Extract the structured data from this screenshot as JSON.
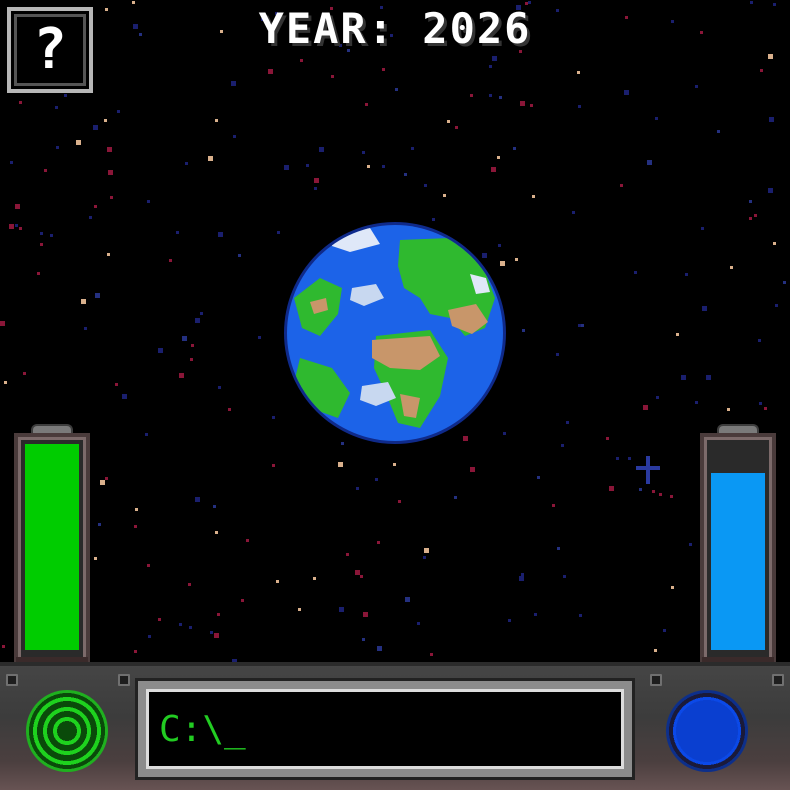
{
  "header": {
    "year_label": "YEAR: 2026"
  },
  "help_button": {
    "label": "?"
  },
  "gauges": {
    "energy": {
      "level": 1.0,
      "color": "#00cc00"
    },
    "water": {
      "level": 0.86,
      "color": "#0a98f4"
    }
  },
  "console": {
    "prompt": "C:\\_"
  },
  "controls": {
    "radar": {
      "icon": "radar-icon",
      "color": "#1ed21e"
    },
    "orb": {
      "icon": "blue-orb-icon",
      "color": "#0b49e8"
    }
  },
  "colors": {
    "space": "#000000",
    "ocean": "#1c63e8",
    "land": "#2fb92f",
    "desert": "#c8966a",
    "cloud": "#c8d8f0"
  }
}
